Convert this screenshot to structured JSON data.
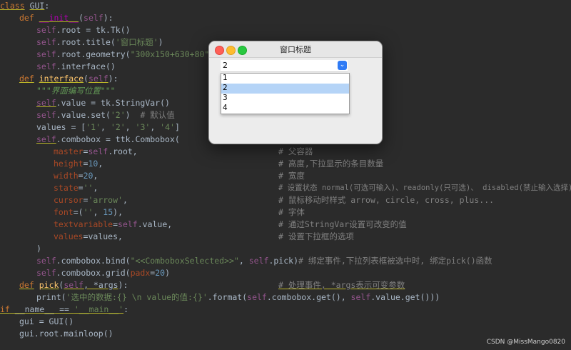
{
  "code": {
    "class_line": {
      "kw": "class",
      "name": "GUI",
      "colon": ":"
    },
    "def_init": {
      "kw": "def",
      "name": "__init__",
      "open": "(",
      "self": "self",
      "close": "):"
    },
    "l_root": {
      "self": "self",
      "rest": ".root = tk.Tk()"
    },
    "l_title": {
      "self": "self",
      "mid": ".root.title(",
      "str": "'窗口标题'",
      "end": ")"
    },
    "l_geom": {
      "self": "self",
      "mid": ".root.geometry(",
      "str": "\"300x150+630+80\"",
      "end": ")"
    },
    "l_iface": {
      "self": "self",
      "rest": ".interface()"
    },
    "def_iface": {
      "kw": "def",
      "name": "interface",
      "open": "(",
      "self": "self",
      "close": "):"
    },
    "docstring": "\"\"\"界面编写位置\"\"\"",
    "l_value": {
      "self": "self",
      "rest": ".value = tk.StringVar()"
    },
    "l_set": {
      "self": "self",
      "mid": ".value.set(",
      "str": "'2'",
      "end": ")",
      "cmt": "# 默认值"
    },
    "l_values": {
      "pre": "values = [",
      "s1": "'1'",
      "c1": ", ",
      "s2": "'2'",
      "c2": ", ",
      "s3": "'3'",
      "c3": ", ",
      "s4": "'4'",
      "end": "]"
    },
    "l_combo": {
      "self": "self",
      "rest": ".combobox = ttk.Combobox("
    },
    "args": [
      {
        "param": "master",
        "eq": "=",
        "v_self": "self",
        "v_rest": ".root,",
        "cmt": "# 父容器"
      },
      {
        "param": "height",
        "eq": "=",
        "v_num": "10",
        "v_rest": ",",
        "cmt": "# 高度,下拉显示的条目数量"
      },
      {
        "param": "width",
        "eq": "=",
        "v_num": "20",
        "v_rest": ",",
        "cmt": "# 宽度"
      },
      {
        "param": "state",
        "eq": "=",
        "v_str": "''",
        "v_rest": ",",
        "cmt": "# 设置状态 normal(可选可输入)、readonly(只可选)、 disabled(禁止输入选择)"
      },
      {
        "param": "cursor",
        "eq": "=",
        "v_str": "'arrow'",
        "v_rest": ",",
        "cmt": "# 鼠标移动时样式 arrow, circle, cross, plus..."
      },
      {
        "param": "font",
        "eq": "=",
        "v_pre": "(",
        "v_str": "''",
        "v_mid": ", ",
        "v_num": "15",
        "v_rest": "),",
        "cmt": "# 字体"
      },
      {
        "param": "textvariable",
        "eq": "=",
        "v_self": "self",
        "v_rest": ".value,",
        "cmt": "# 通过StringVar设置可改变的值"
      },
      {
        "param": "values",
        "eq": "=",
        "v_plain": "values,",
        "cmt": "# 设置下拉框的选项"
      }
    ],
    "l_close": ")",
    "l_bind": {
      "self": "self",
      "mid": ".combobox.bind(",
      "str": "\"<<ComboboxSelected>>\"",
      "c": ", ",
      "self2": "self",
      "rest": ".pick)",
      "cmt": "# 绑定事件,下拉列表框被选中时, 绑定pick()函数"
    },
    "l_grid": {
      "self": "self",
      "mid": ".combobox.grid(",
      "param": "padx",
      "eq": "=",
      "num": "20",
      "end": ")"
    },
    "def_pick": {
      "kw": "def",
      "name": "pick",
      "open": "(",
      "self": "self",
      "mid": ", *",
      "args": "args",
      "close": "):",
      "cmt": "# 处理事件, *args表示可变参数"
    },
    "l_print": {
      "pre": "print(",
      "str": "'选中的数据:{} \\n value的值:{}'",
      "mid": ".format(",
      "self": "self",
      "mid2": ".combobox.get(), ",
      "self2": "self",
      "end": ".value.get()))"
    },
    "l_if": {
      "kw": "if",
      "name": " __name__",
      "eq": " == ",
      "str": "'__main__'",
      "colon": ":"
    },
    "l_gui": "gui = GUI()",
    "l_loop": "gui.root.mainloop()"
  },
  "window": {
    "title": "窗口标题",
    "combo_value": "2",
    "combo_arrow": "⌄",
    "options": [
      "1",
      "2",
      "3",
      "4"
    ],
    "selected_index": 1
  },
  "watermark": "CSDN @MissMango0820"
}
